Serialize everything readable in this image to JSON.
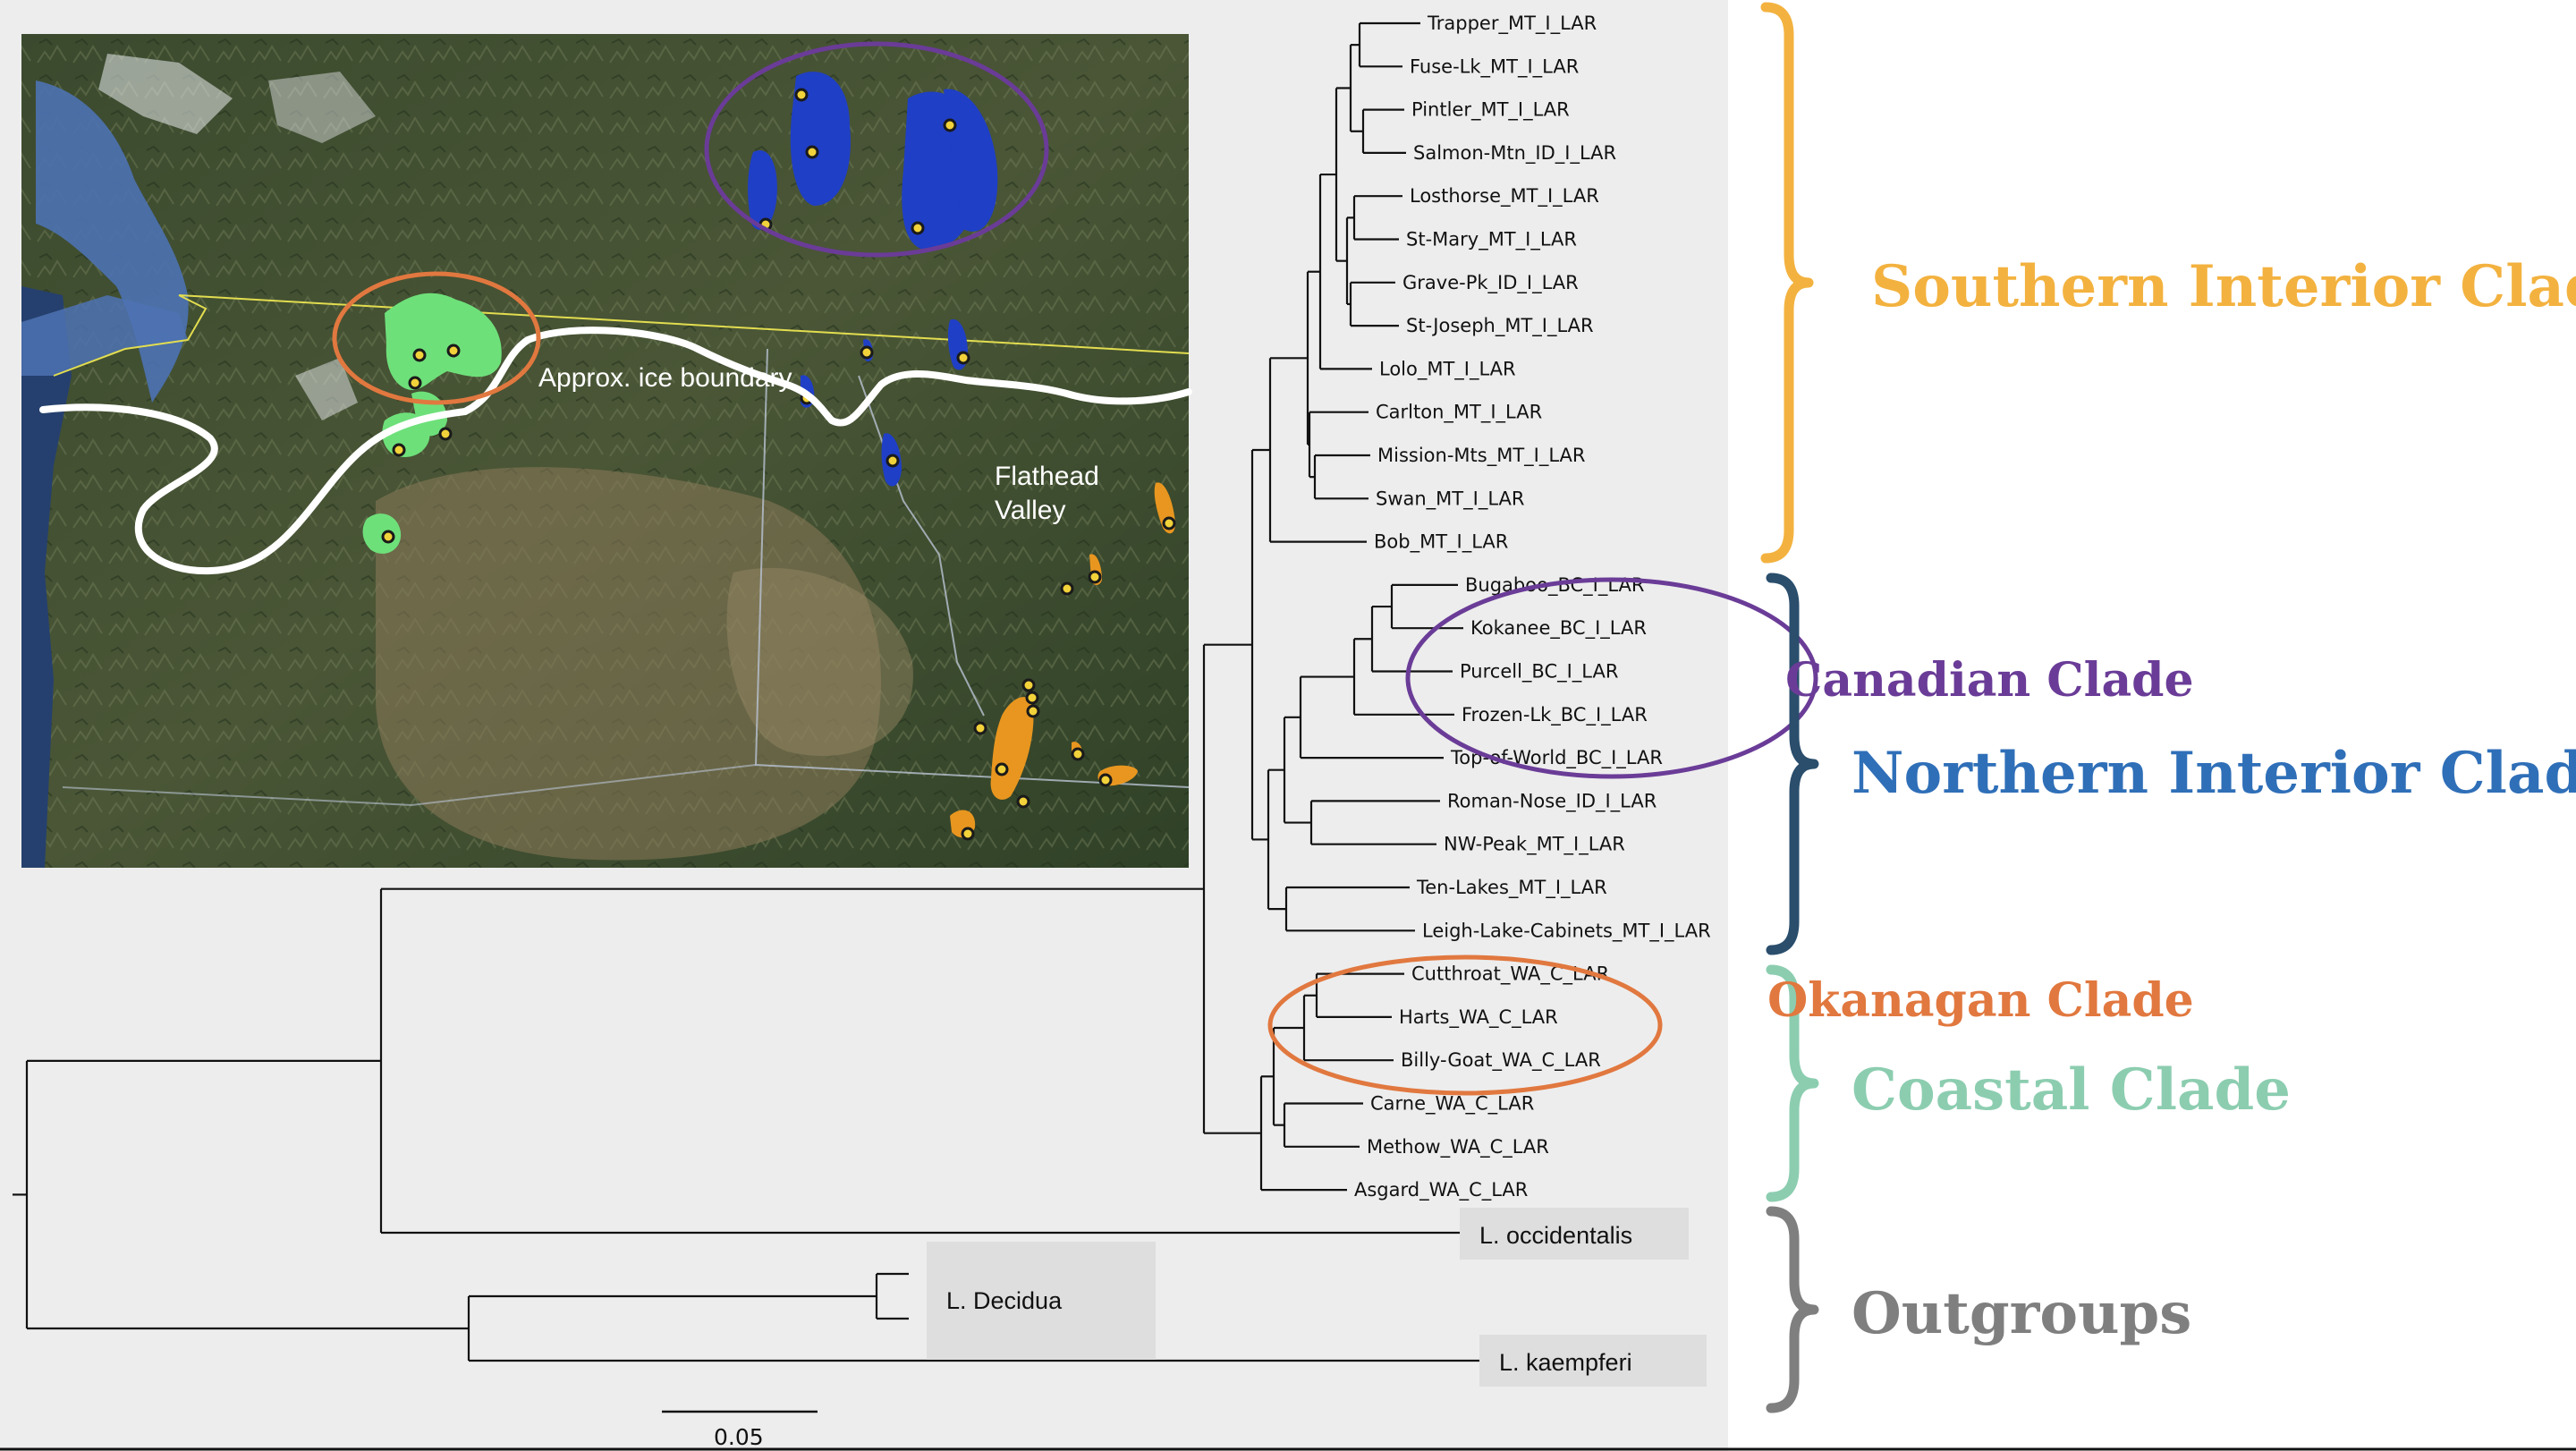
{
  "tree": {
    "tips": [
      "Trapper_MT_I_LAR",
      "Fuse-Lk_MT_I_LAR",
      "Pintler_MT_I_LAR",
      "Salmon-Mtn_ID_I_LAR",
      "Losthorse_MT_I_LAR",
      "St-Mary_MT_I_LAR",
      "Grave-Pk_ID_I_LAR",
      "St-Joseph_MT_I_LAR",
      "Lolo_MT_I_LAR",
      "Carlton_MT_I_LAR",
      "Mission-Mts_MT_I_LAR",
      "Swan_MT_I_LAR",
      "Bob_MT_I_LAR",
      "Bugaboo_BC_I_LAR",
      "Kokanee_BC_I_LAR",
      "Purcell_BC_I_LAR",
      "Frozen-Lk_BC_I_LAR",
      "Top-of-World_BC_I_LAR",
      "Roman-Nose_ID_I_LAR",
      "NW-Peak_MT_I_LAR",
      "Ten-Lakes_MT_I_LAR",
      "Leigh-Lake-Cabinets_MT_I_LAR",
      "Cutthroat_WA_C_LAR",
      "Harts_WA_C_LAR",
      "Billy-Goat_WA_C_LAR",
      "Carne_WA_C_LAR",
      "Methow_WA_C_LAR",
      "Asgard_WA_C_LAR"
    ],
    "outgroups": {
      "occidentalis": "L. occidentalis",
      "decidua": "L. Decidua",
      "kaempferi": "L. kaempferi"
    },
    "scale_bar": "0.05"
  },
  "clades": {
    "southern_interior": {
      "label": "Southern Interior Clade",
      "color": "#f3b23f"
    },
    "canadian": {
      "label": "Canadian Clade",
      "color": "#6a3c97"
    },
    "northern_interior": {
      "label": "Northern Interior Clade",
      "color": "#2f6fb8"
    },
    "okanagan": {
      "label": "Okanagan Clade",
      "color": "#e1783f"
    },
    "coastal": {
      "label": "Coastal Clade",
      "color": "#8ccdb0"
    },
    "outgroups": {
      "label": "Outgroups",
      "color": "#7f7f7f"
    }
  },
  "bracket_colors": {
    "southern": "#f3b23f",
    "northern": "#2a4e6c",
    "coastal": "#8ccdb0",
    "outgroups": "#7f7f7f"
  },
  "map": {
    "ice_boundary_label": "Approx. ice boundary",
    "flathead_line1": "Flathead",
    "flathead_line2": "Valley",
    "colors": {
      "interior": "#1f3fc6",
      "canadian_circle": "#6a3c97",
      "okanagan_circle": "#e1783f",
      "coastal": "#6ee07a",
      "southern": "#e8961f",
      "ice_line": "#ffffff"
    }
  }
}
